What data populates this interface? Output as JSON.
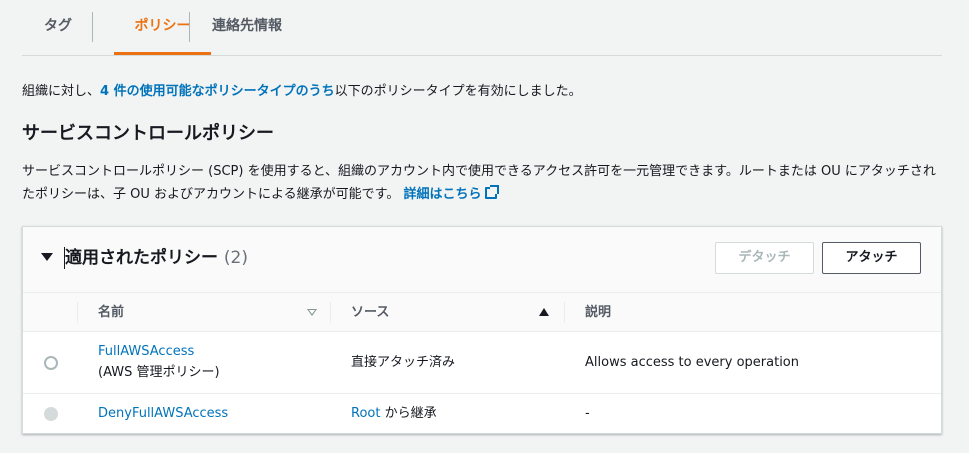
{
  "tabs": [
    {
      "label": "タグ"
    },
    {
      "label": "ポリシー"
    },
    {
      "label": "連絡先情報"
    }
  ],
  "intro": {
    "prefix": "組織に対し、",
    "link": "4 件の使用可能なポリシータイプのうち",
    "suffix": "以下のポリシータイプを有効にしました。"
  },
  "section": {
    "title": "サービスコントロールポリシー",
    "description": "サービスコントロールポリシー (SCP) を使用すると、組織のアカウント内で使用できるアクセス許可を一元管理できます。ルートまたは OU にアタッチされたポリシーは、子 OU およびアカウントによる継承が可能です。",
    "learn_more": "詳細はこちら"
  },
  "panel": {
    "title": "適用されたポリシー",
    "count": "(2)",
    "detach_label": "デタッチ",
    "attach_label": "アタッチ",
    "columns": [
      "名前",
      "ソース",
      "説明"
    ],
    "rows": [
      {
        "name": "FullAWSAccess",
        "name_sub": "(AWS 管理ポリシー)",
        "source_link": "",
        "source": "直接アタッチ済み",
        "description": "Allows access to every operation"
      },
      {
        "name": "DenyFullAWSAccess",
        "name_sub": "",
        "source_link": "Root",
        "source": " から継承",
        "description": "-"
      }
    ]
  },
  "colors": {
    "accent": "#ec7211",
    "link": "#0073bb",
    "background": "#f2f3f3"
  },
  "icons": [
    "caret-down-icon",
    "sort-desc-icon",
    "sort-asc-icon",
    "external-link-icon",
    "radio-icon"
  ]
}
